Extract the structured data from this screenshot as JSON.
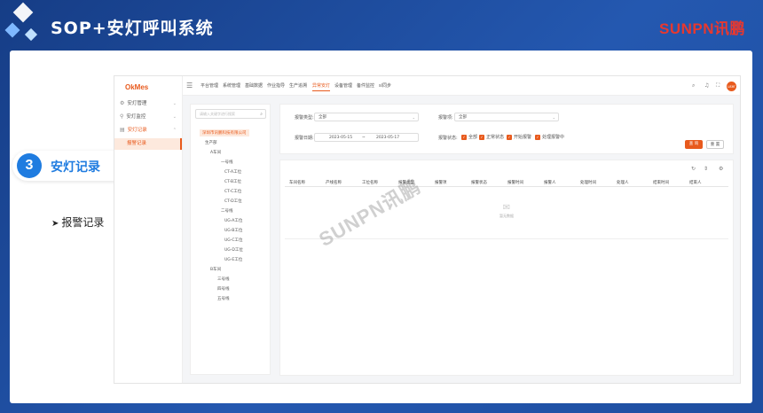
{
  "slide": {
    "title": "SOP+安灯呼叫系统",
    "brand_latin": "SUNPN",
    "brand_cn": "讯鹏",
    "step_number": "3",
    "step_label": "安灯记录",
    "bullet": "报警记录"
  },
  "app": {
    "logo": "OkMes",
    "sidebar": [
      {
        "label": "安灯管理",
        "icon": "gear-icon"
      },
      {
        "label": "安灯监控",
        "icon": "pin-icon"
      },
      {
        "label": "安灯记录",
        "icon": "doc-icon",
        "active": true
      }
    ],
    "sidebar_sub": "报警记录",
    "tabs": [
      "平台管理",
      "系统管理",
      "基础数据",
      "作业指导",
      "生产追溯",
      "异常安灯",
      "设备管理",
      "备件监控",
      "sl同步"
    ],
    "active_tab": "异常安灯",
    "avatar": "user",
    "tree_search_placeholder": "请输入关键字进行搜索",
    "tree": [
      {
        "label": "深圳市讯鹏科技有限公司",
        "selected": true
      },
      {
        "label": "生产部"
      },
      {
        "label": "A车间"
      },
      {
        "label": "一号线"
      },
      {
        "label": "CT-A工位"
      },
      {
        "label": "CT-B工位"
      },
      {
        "label": "CT-C工位"
      },
      {
        "label": "CT-D工位"
      },
      {
        "label": "二号线"
      },
      {
        "label": "UG-A工位"
      },
      {
        "label": "UG-B工位"
      },
      {
        "label": "UG-C工位"
      },
      {
        "label": "UG-D工位"
      },
      {
        "label": "UG-E工位"
      },
      {
        "label": "B车间"
      },
      {
        "label": "三号线"
      },
      {
        "label": "四号线"
      },
      {
        "label": "五号线"
      }
    ],
    "filters": {
      "alarm_type_label": "报警类型:",
      "alarm_type_value": "全部",
      "alarm_item_label": "报警项:",
      "alarm_item_value": "全部",
      "date_label": "报警日期:",
      "date_start": "2023-05-15",
      "date_sep": "~",
      "date_end": "2023-05-17",
      "status_label": "报警状态:",
      "status_options": [
        "全部",
        "正常状态",
        "开始报警",
        "处理报警中"
      ]
    },
    "buttons": {
      "query": "查 询",
      "reset": "重 置"
    },
    "table_headers": [
      "车间名称",
      "产线名称",
      "工位名称",
      "报警类型",
      "报警项",
      "报警状态",
      "报警时间",
      "报警人",
      "处理时间",
      "处理人",
      "结束时间",
      "结束人"
    ],
    "empty_text": "暂无数据",
    "watermark": "SUNPN讯鹏"
  }
}
